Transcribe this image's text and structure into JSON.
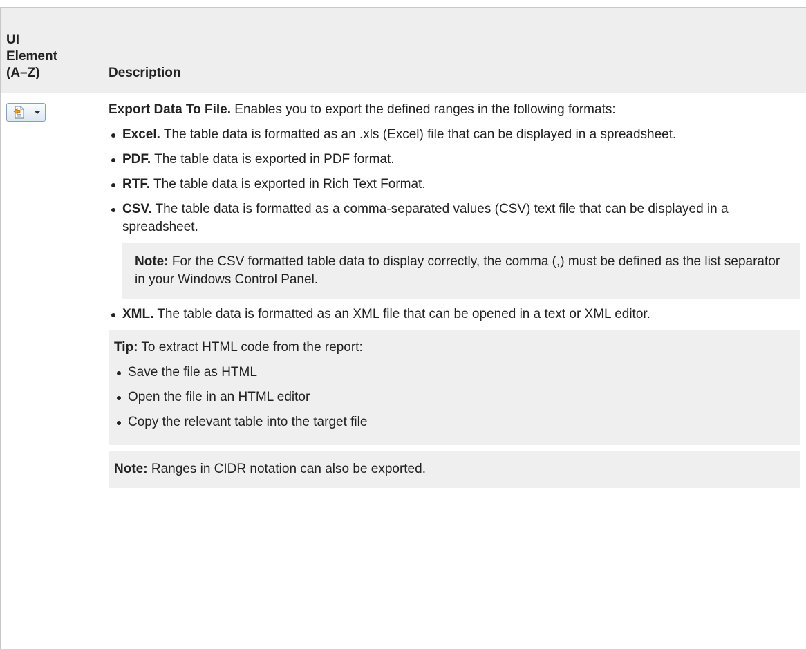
{
  "table": {
    "headers": {
      "ui_element": "UI Element (A–Z)",
      "description": "Description"
    },
    "row": {
      "icon": "export-data-to-file-icon",
      "title": "Export Data To File.",
      "intro": "Enables you to export the defined ranges in the following formats:",
      "formats": [
        {
          "name": "Excel.",
          "text": "The table data is formatted as an .xls (Excel) file that can be displayed in a spreadsheet."
        },
        {
          "name": "PDF.",
          "text": "The table data is exported in PDF format."
        },
        {
          "name": "RTF.",
          "text": "The table data is exported in Rich Text Format."
        },
        {
          "name": "CSV.",
          "text": "The table data is formatted as a comma-separated values (CSV) text file that can be displayed in a spreadsheet."
        }
      ],
      "csv_note": {
        "label": "Note:",
        "text": "For the CSV formatted table data to display correctly, the comma (,) must be defined as the list separator in your Windows Control Panel."
      },
      "xml": {
        "name": "XML.",
        "text": "The table data is formatted as an XML file that can be opened in a text or XML editor."
      },
      "tip": {
        "label": "Tip:",
        "text": "To extract HTML code from the report:",
        "steps": [
          "Save the file as HTML",
          "Open the file in an HTML editor",
          "Copy the relevant table into the target file"
        ]
      },
      "final_note": {
        "label": "Note:",
        "text": "Ranges in CIDR notation can also be exported."
      }
    }
  }
}
